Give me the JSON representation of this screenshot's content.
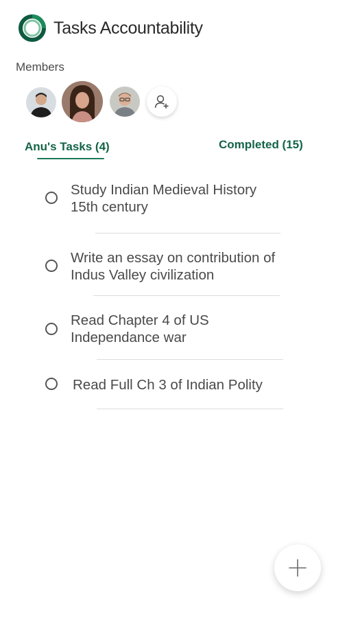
{
  "app": {
    "title": "Tasks Accountability",
    "brand_color": "#136447"
  },
  "members": {
    "label": "Members",
    "avatars": [
      "member-1",
      "member-2",
      "member-3"
    ],
    "add_icon": "add-person-icon"
  },
  "tabs": {
    "tasks_label": "Anu's Tasks (4)",
    "completed_label": "Completed (15)",
    "active": "tasks"
  },
  "tasks": [
    {
      "line1": "Study Indian Medieval History",
      "line2": "15th century",
      "completed": false
    },
    {
      "line1": "Write an essay on contribution of",
      "line2": "Indus Valley civilization",
      "completed": false
    },
    {
      "line1": "Read Chapter 4 of US",
      "line2": "Independance war",
      "completed": false
    },
    {
      "line1": "Read Full Ch 3 of Indian Polity",
      "line2": "",
      "completed": false
    }
  ],
  "fab": {
    "icon": "plus-icon"
  }
}
